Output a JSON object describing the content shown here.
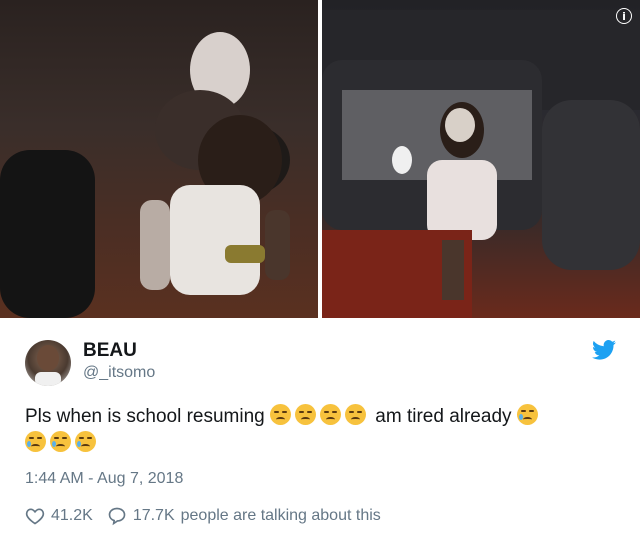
{
  "photos": {
    "left_icon": "photo-left",
    "right_icon": "photo-right",
    "info_icon": "info-icon",
    "info_glyph": "i"
  },
  "tweet": {
    "display_name": "BEAU",
    "handle": "@_itsomo",
    "text_main": "Pls when is school resuming",
    "text_after": "am tired already",
    "timestamp": "1:44 AM - Aug 7, 2018",
    "likes": "41.2K",
    "replies": "17.7K",
    "talking_text": "people are talking about this",
    "brand_color": "#1da1f2"
  }
}
